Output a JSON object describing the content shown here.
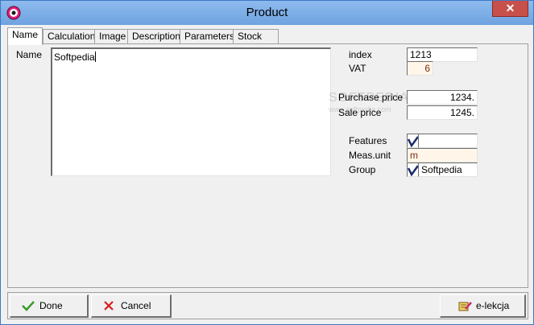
{
  "window": {
    "title": "Product",
    "close_glyph": "✕"
  },
  "tabs": [
    "Name",
    "Calculation",
    "Image",
    "Description",
    "Parameters",
    "Stock"
  ],
  "form": {
    "name_label": "Name",
    "name_value": "Softpedia",
    "index_label": "index",
    "index_value": "1213",
    "vat_label": "VAT",
    "vat_value": "6",
    "purchase_price_label": "Purchase price",
    "purchase_price_value": "1234.",
    "sale_price_label": "Sale price",
    "sale_price_value": "1245.",
    "features_label": "Features",
    "features_value": "",
    "meas_unit_label": "Meas.unit",
    "meas_unit_value": "m",
    "group_label": "Group",
    "group_value": "Softpedia"
  },
  "watermark": {
    "text": "SOFTPEDIA",
    "url": "www.softpedia.com"
  },
  "footer": {
    "done_label": "Done",
    "cancel_label": "Cancel",
    "elekcja_label": "e-lekcja"
  },
  "colors": {
    "title_bar": "#7eb2ea",
    "close_button": "#c7504b",
    "done_check": "#3a9a2a",
    "cancel_x": "#d62020"
  },
  "icons": {
    "app": "app-icon",
    "done": "check-icon",
    "cancel": "x-icon",
    "elekcja": "book-pencil-icon",
    "checkmark": "checkmark-icon"
  }
}
